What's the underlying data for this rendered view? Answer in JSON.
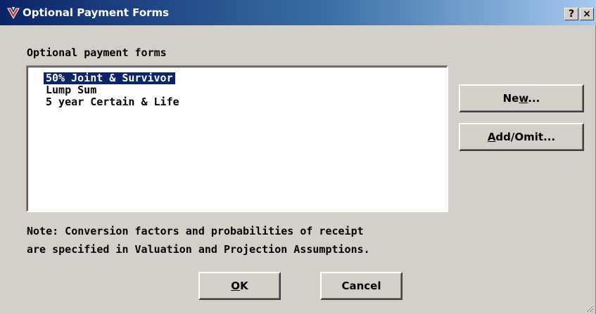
{
  "window": {
    "title": "Optional Payment Forms",
    "help_button": "?",
    "close_button": "×"
  },
  "list": {
    "label": "Optional payment forms",
    "items": [
      {
        "label": "50% Joint & Survivor",
        "selected": true
      },
      {
        "label": "Lump Sum",
        "selected": false
      },
      {
        "label": "5 year Certain & Life",
        "selected": false
      }
    ]
  },
  "buttons": {
    "new": {
      "prefix": "Ne",
      "accel": "w",
      "suffix": "..."
    },
    "add_omit": {
      "prefix": "",
      "accel": "A",
      "suffix": "dd/Omit..."
    },
    "ok": {
      "prefix": "",
      "accel": "O",
      "suffix": "K"
    },
    "cancel": "Cancel"
  },
  "note": {
    "line1": "Note: Conversion factors and probabilities of receipt",
    "line2": "are specified in Valuation and Projection Assumptions."
  },
  "colors": {
    "title_gradient_start": "#0a246a",
    "title_gradient_end": "#a6caf0",
    "selection": "#0a246a",
    "face": "#d4d0c8"
  }
}
